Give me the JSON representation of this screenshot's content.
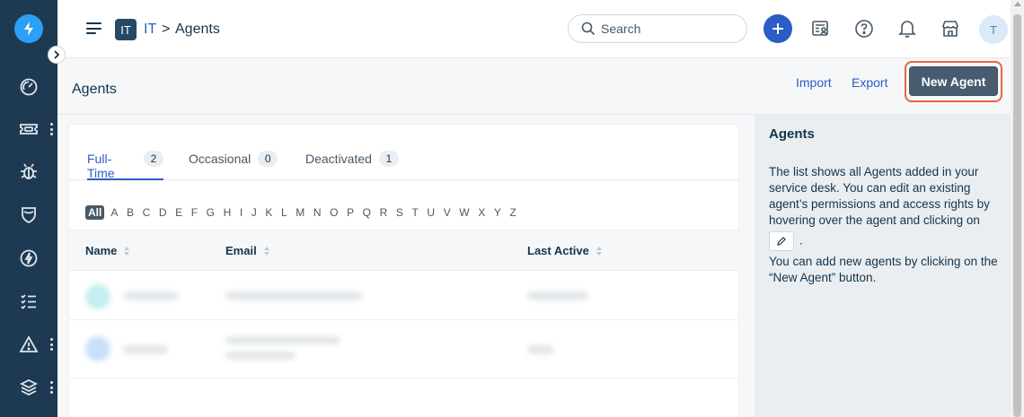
{
  "header": {
    "workspace_badge": "IT",
    "workspace_name": "IT",
    "separator": ">",
    "page_name": "Agents",
    "search_placeholder": "Search",
    "avatar_initial": "T"
  },
  "subheader": {
    "title": "Agents",
    "import_label": "Import",
    "export_label": "Export",
    "new_agent_label": "New Agent"
  },
  "tabs": [
    {
      "label": "Full-Time",
      "count": "2",
      "active": true
    },
    {
      "label": "Occasional",
      "count": "0",
      "active": false
    },
    {
      "label": "Deactivated",
      "count": "1",
      "active": false
    }
  ],
  "alphabet": [
    "All",
    "A",
    "B",
    "C",
    "D",
    "E",
    "F",
    "G",
    "H",
    "I",
    "J",
    "K",
    "L",
    "M",
    "N",
    "O",
    "P",
    "Q",
    "R",
    "S",
    "T",
    "U",
    "V",
    "W",
    "X",
    "Y",
    "Z"
  ],
  "table": {
    "columns": [
      "Name",
      "Email",
      "Last Active"
    ]
  },
  "info_panel": {
    "title": "Agents",
    "paragraph1": "The list shows all Agents added in your service desk. You can edit an existing agent’s permissions and access rights by hovering over the agent and clicking on",
    "paragraph1_end": ".",
    "paragraph2": "You can add new agents by clicking on the “New Agent” button."
  },
  "sidebar_icons": [
    "dashboard-icon",
    "ticket-icon",
    "bug-icon",
    "shield-icon",
    "bolt-icon",
    "checklist-icon",
    "alert-icon",
    "layers-icon"
  ],
  "colors": {
    "sidebar": "#1e3a52",
    "accent": "#2c5cc5",
    "highlight_ring": "#e8663b",
    "primary_button": "#475c6e"
  }
}
